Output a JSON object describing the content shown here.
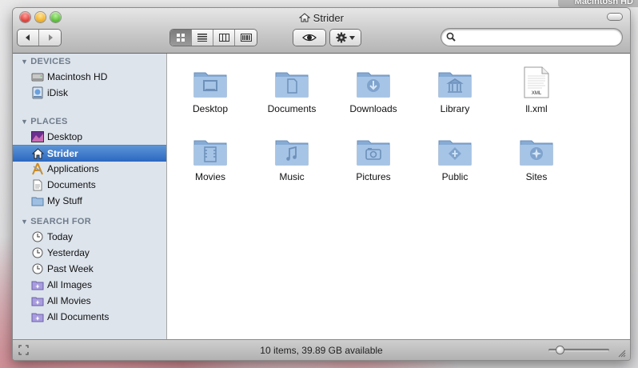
{
  "desktop": {
    "volume_label": "Macintosh HD"
  },
  "window": {
    "title": "Strider",
    "status": "10 items, 39.89 GB available",
    "zoom_slider_level": 0.15
  },
  "toolbar": {
    "nav": [
      {
        "icon": "back-arrow-icon"
      },
      {
        "icon": "forward-arrow-icon"
      }
    ],
    "views": [
      {
        "icon": "icon-view-icon",
        "active": true
      },
      {
        "icon": "list-view-icon",
        "active": false
      },
      {
        "icon": "column-view-icon",
        "active": false
      },
      {
        "icon": "cover-flow-icon",
        "active": false
      }
    ],
    "quicklook_icon": "eye-icon",
    "action_icon": "gear-icon",
    "search": {
      "placeholder": "",
      "value": ""
    }
  },
  "sidebar": {
    "devices": {
      "heading": "DEVICES",
      "items": [
        {
          "label": "Macintosh HD",
          "icon": "hard-drive-icon"
        },
        {
          "label": "iDisk",
          "icon": "idisk-icon"
        }
      ]
    },
    "places": {
      "heading": "PLACES",
      "items": [
        {
          "label": "Desktop",
          "icon": "desktop-icon"
        },
        {
          "label": "Strider",
          "icon": "home-icon",
          "selected": true
        },
        {
          "label": "Applications",
          "icon": "applications-icon"
        },
        {
          "label": "Documents",
          "icon": "document-icon"
        },
        {
          "label": "My Stuff",
          "icon": "folder-icon"
        }
      ]
    },
    "search_for": {
      "heading": "SEARCH FOR",
      "items": [
        {
          "label": "Today",
          "icon": "clock-icon"
        },
        {
          "label": "Yesterday",
          "icon": "clock-icon"
        },
        {
          "label": "Past Week",
          "icon": "clock-icon"
        },
        {
          "label": "All Images",
          "icon": "smart-folder-icon"
        },
        {
          "label": "All Movies",
          "icon": "smart-folder-icon"
        },
        {
          "label": "All Documents",
          "icon": "smart-folder-icon"
        }
      ]
    }
  },
  "content": {
    "items": [
      {
        "label": "Desktop",
        "icon": "desktop-folder-icon"
      },
      {
        "label": "Documents",
        "icon": "documents-folder-icon"
      },
      {
        "label": "Downloads",
        "icon": "downloads-folder-icon"
      },
      {
        "label": "Library",
        "icon": "library-folder-icon"
      },
      {
        "label": "ll.xml",
        "icon": "xml-file-icon",
        "badge": "XML"
      },
      {
        "label": "Movies",
        "icon": "movies-folder-icon"
      },
      {
        "label": "Music",
        "icon": "music-folder-icon"
      },
      {
        "label": "Pictures",
        "icon": "pictures-folder-icon"
      },
      {
        "label": "Public",
        "icon": "public-folder-icon"
      },
      {
        "label": "Sites",
        "icon": "sites-folder-icon"
      }
    ]
  },
  "colors": {
    "selection": "#3a77c9",
    "sidebar_bg": "#dde4ec",
    "folder_blue": "#8fb3d9",
    "section_heading": "#6f7c8b"
  }
}
